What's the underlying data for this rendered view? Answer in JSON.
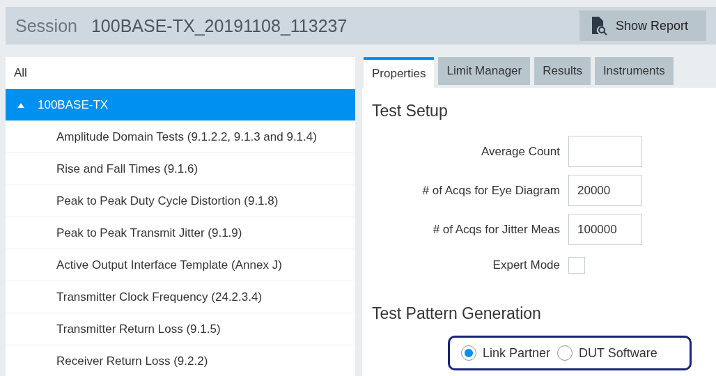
{
  "header": {
    "label": "Session",
    "title": "100BASE-TX_20191108_113237",
    "button": "Show Report"
  },
  "tree": {
    "all": {
      "label": "All",
      "selected": false
    },
    "root": {
      "label": "100BASE-TX",
      "expanded": true,
      "selected": true,
      "children": [
        {
          "label": "Amplitude Domain Tests (9.1.2.2, 9.1.3 and 9.1.4)",
          "selected": false
        },
        {
          "label": "Rise and Fall Times (9.1.6)",
          "selected": false
        },
        {
          "label": "Peak to Peak Duty Cycle Distortion (9.1.8)",
          "selected": false
        },
        {
          "label": "Peak to Peak Transmit Jitter (9.1.9)",
          "selected": false
        },
        {
          "label": "Active Output Interface Template (Annex J)",
          "selected": false
        },
        {
          "label": "Transmitter Clock Frequency (24.2.3.4)",
          "selected": false
        },
        {
          "label": "Transmitter Return Loss (9.1.5)",
          "selected": false
        },
        {
          "label": "Receiver Return Loss (9.2.2)",
          "selected": false
        }
      ]
    }
  },
  "tabs": [
    {
      "label": "Properties",
      "selected": true
    },
    {
      "label": "Limit Manager",
      "selected": false
    },
    {
      "label": "Results",
      "selected": false
    },
    {
      "label": "Instruments",
      "selected": false
    }
  ],
  "test_setup": {
    "title": "Test Setup",
    "fields": [
      {
        "kind": "input",
        "label": "Average Count"
      },
      {
        "kind": "input",
        "label": "# of Acqs for Eye Diagram",
        "value": "20000"
      },
      {
        "kind": "input",
        "label": "# of Acqs for Jitter Meas",
        "value": "100000"
      },
      {
        "kind": "checkbox",
        "label": "Expert Mode",
        "checked": false
      }
    ]
  },
  "pattern": {
    "title": "Test Pattern Generation",
    "options": [
      {
        "label": "Link Partner",
        "selected": true
      },
      {
        "label": "DUT Software",
        "selected": false
      }
    ]
  }
}
